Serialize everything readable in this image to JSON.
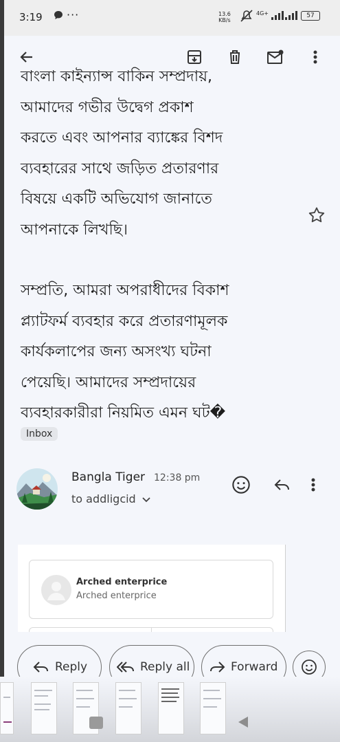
{
  "status_bar": {
    "time": "3:19",
    "network_rate": "13.6",
    "network_rate_unit": "KB/s",
    "signal_label": "4G+",
    "battery": "57"
  },
  "toolbar": {
    "back_icon": "arrow-left-icon",
    "archive_icon": "archive-icon",
    "delete_icon": "trash-icon",
    "mark_unread_icon": "mail-unread-icon",
    "more_icon": "more-vert-icon"
  },
  "message": {
    "paragraph_1_lines": [
      "বাংলা কাইন্যান্স বাকিন সম্প্রদায়,",
      "আমাদের গভীর উদ্বেগ প্রকাশ",
      "করতে এবং আপনার ব্যাঙ্কের বিশদ",
      "ব্যবহারের সাথে জড়িত প্রতারণার",
      "বিষয়ে একটি অভিযোগ জানাতে",
      "আপনাকে লিখছি।"
    ],
    "paragraph_2_lines": [
      "সম্প্রতি, আমরা অপরাধীদের বিকাশ",
      "প্ল্যাটফর্ম ব্যবহার করে প্রতারণামূলক",
      "কার্যকলাপের জন্য অসংখ্য ঘটনা",
      "পেয়েছি। আমাদের সম্প্রদায়ের",
      "ব্যবহারকারীরা নিয়মিত এমন ঘট�"
    ],
    "label_chip": "Inbox"
  },
  "reply_header": {
    "sender": "Bangla Tiger",
    "time": "12:38 pm",
    "to_line": "to addligcid"
  },
  "embedded_card": {
    "name": "Arched enterprice",
    "subtitle": "Arched enterprice"
  },
  "actions": {
    "reply": "Reply",
    "reply_all": "Reply all",
    "forward": "Forward"
  },
  "colors": {
    "background": "#f4f6fb",
    "text": "#1d1d1d",
    "chip_bg": "#e4e6ea",
    "border": "#6f6f6f"
  }
}
